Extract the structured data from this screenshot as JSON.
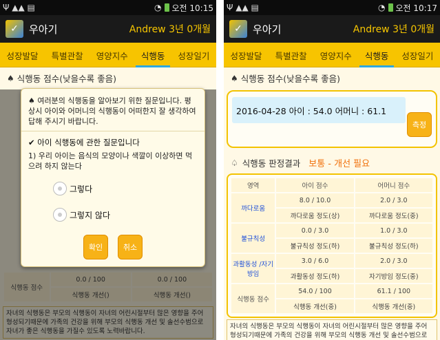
{
  "left": {
    "status": {
      "time": "오전 10:15"
    },
    "app": {
      "title": "우아기",
      "user": "Andrew 3년 0개월"
    },
    "tabs": [
      "성장발달",
      "특별관찰",
      "영양지수",
      "식행동",
      "성장일기"
    ],
    "section_title": "식행동 점수(낮을수록 좋음)",
    "dialog": {
      "intro": "여러분의 식행동을 알아보기 위한 질문입니다. 평상시 아이와 어머니의 식행동이 어떠한지 잘 생각하여 답해 주시기 바랍니다.",
      "question_title": "아이 식행동에 관한 질문입니다",
      "question_text": "1) 우리 아이는 음식의 모양이나 색깔이 이상하면 먹으려 하지 않는다",
      "options": [
        "그렇다",
        "그렇지 않다"
      ],
      "confirm": "확인",
      "cancel": "취소"
    },
    "bg_total": {
      "label": "식행동 점수",
      "child_score": "0.0 / 100",
      "mother_score": "0.0 / 100",
      "child_level": "식행동 개선()",
      "mother_level": "식행동 개선()"
    },
    "footer": "자녀의 식행동은 부모의 식행동이 자녀의 어린시절부터 많은 영향을 주어 형성되기때문에 가족의 건강을 위해 부모의 식행동 개선 및 솔선수범으로 자녀가 좋은 식행동을 가질수 있도록 노력바랍니다."
  },
  "right": {
    "status": {
      "time": "오전 10:17"
    },
    "app": {
      "title": "우아기",
      "user": "Andrew 3년 0개월"
    },
    "tabs": [
      "성장발달",
      "특별관찰",
      "영양지수",
      "식행동",
      "성장일기"
    ],
    "section_title": "식행동 점수(낮을수록 좋음)",
    "score_line": "2016-04-28  아이 : 54.0  어머니 : 61.1",
    "measure": "측정",
    "result_title": "식행동 판정결과",
    "result_status": "보통 - 개선 필요",
    "table": {
      "headers": [
        "영역",
        "아이 점수",
        "어머니 점수"
      ],
      "rows": [
        {
          "area": "까다로움",
          "child_score": "8.0 / 10.0",
          "mother_score": "2.0 / 3.0",
          "child_level": "까다로움 정도(상)",
          "mother_level": "까다로움 정도(중)"
        },
        {
          "area": "불규칙성",
          "child_score": "0.0 / 3.0",
          "mother_score": "1.0 / 3.0",
          "child_level": "불규칙성 정도(하)",
          "mother_level": "불규칙성 정도(하)"
        },
        {
          "area": "과활동성 /자기방임",
          "child_score": "3.0 / 6.0",
          "mother_score": "2.0 / 3.0",
          "child_level": "과활동성 정도(하)",
          "mother_level": "자기방임 정도(중)"
        },
        {
          "area": "식행동 점수",
          "child_score": "54.0 / 100",
          "mother_score": "61.1 / 100",
          "child_level": "식행동 개선(중)",
          "mother_level": "식행동 개선(중)"
        }
      ]
    },
    "footer": "자녀의 식행동은 부모의 식행동이 자녀의 어린시절부터 많은 영향을 주어 형성되기때문에 가족의 건강을 위해 부모의 식행동 개선 및 솔선수범으로 자녀가 좋은 식행동을 가질수 있도록 노력바랍니다."
  }
}
